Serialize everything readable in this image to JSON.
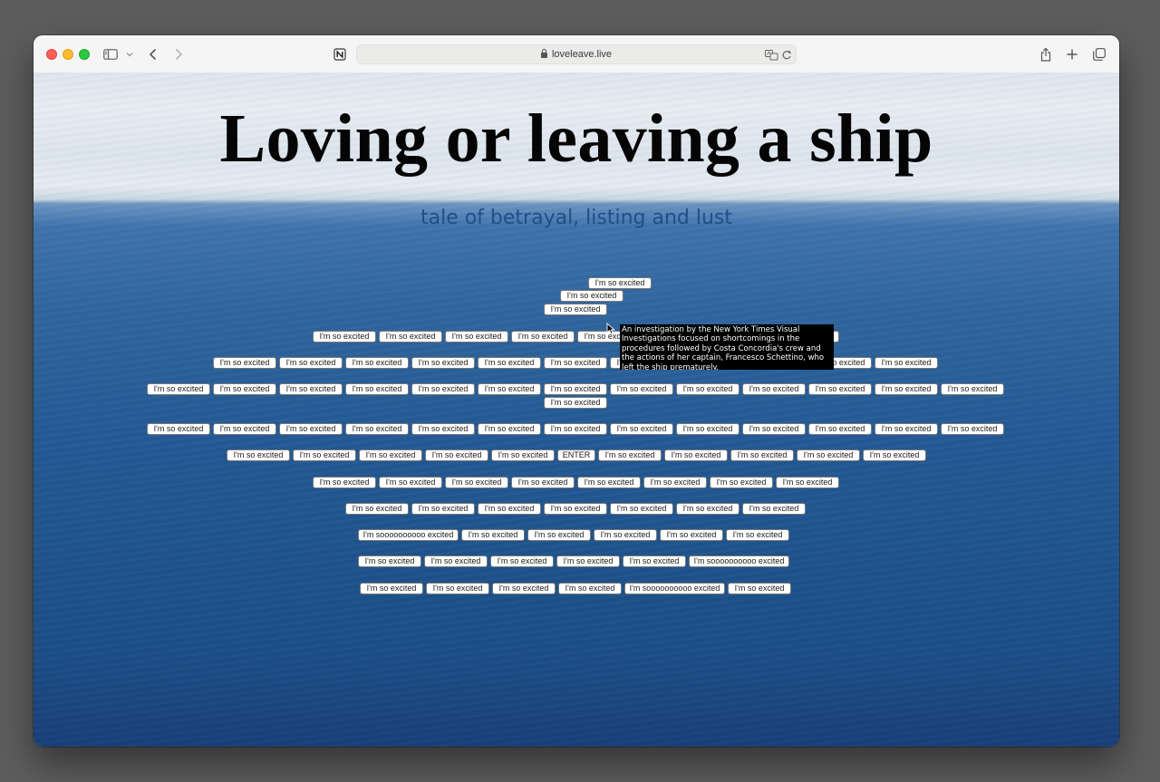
{
  "browser": {
    "url": "loveleave.live"
  },
  "page": {
    "title": "Loving or leaving a ship",
    "subtitle": "tale of betrayal, listing and lust",
    "tooltip": "An investigation by the New York Times Visual Investigations focused on shortcomings in the procedures followed by Costa Concordia's crew and the actions of her captain, Francesco Schettino, who left the ship prematurely.",
    "button_label": "I'm so excited",
    "long_label": "I'm soooooooooo excited",
    "enter_label": "ENTER"
  },
  "rows": [
    [
      {
        "t": "s"
      }
    ],
    [
      {
        "t": "s"
      }
    ],
    [
      {
        "t": "s"
      }
    ],
    [
      {
        "t": "s"
      },
      {
        "t": "s"
      },
      {
        "t": "s"
      },
      {
        "t": "s"
      },
      {
        "t": "s"
      },
      {
        "t": "s"
      },
      {
        "t": "s"
      },
      {
        "t": "s"
      }
    ],
    [
      {
        "t": "s"
      },
      {
        "t": "s"
      },
      {
        "t": "s"
      },
      {
        "t": "s"
      },
      {
        "t": "s"
      },
      {
        "t": "s"
      },
      {
        "t": "s"
      },
      {
        "t": "s"
      },
      {
        "t": "s"
      },
      {
        "t": "s"
      },
      {
        "t": "s"
      }
    ],
    [
      {
        "t": "s"
      },
      {
        "t": "s"
      },
      {
        "t": "s"
      },
      {
        "t": "s"
      },
      {
        "t": "s"
      },
      {
        "t": "s"
      },
      {
        "t": "s"
      },
      {
        "t": "s"
      },
      {
        "t": "s"
      },
      {
        "t": "s"
      },
      {
        "t": "s"
      },
      {
        "t": "s"
      },
      {
        "t": "s"
      }
    ],
    [
      {
        "t": "s"
      }
    ],
    [
      {
        "t": "s"
      },
      {
        "t": "s"
      },
      {
        "t": "s"
      },
      {
        "t": "s"
      },
      {
        "t": "s"
      },
      {
        "t": "s"
      },
      {
        "t": "s"
      },
      {
        "t": "s"
      },
      {
        "t": "s"
      },
      {
        "t": "s"
      },
      {
        "t": "s"
      },
      {
        "t": "s"
      },
      {
        "t": "s"
      }
    ],
    [
      {
        "t": "s"
      },
      {
        "t": "s"
      },
      {
        "t": "s"
      },
      {
        "t": "s"
      },
      {
        "t": "s"
      },
      {
        "t": "e"
      },
      {
        "t": "s"
      },
      {
        "t": "s"
      },
      {
        "t": "s"
      },
      {
        "t": "s"
      },
      {
        "t": "s"
      }
    ],
    [
      {
        "t": "s"
      },
      {
        "t": "s"
      },
      {
        "t": "s"
      },
      {
        "t": "s"
      },
      {
        "t": "s"
      },
      {
        "t": "s"
      },
      {
        "t": "s"
      },
      {
        "t": "s"
      }
    ],
    [
      {
        "t": "s"
      },
      {
        "t": "s"
      },
      {
        "t": "s"
      },
      {
        "t": "s"
      },
      {
        "t": "s"
      },
      {
        "t": "s"
      },
      {
        "t": "s"
      }
    ],
    [
      {
        "t": "l"
      },
      {
        "t": "s"
      },
      {
        "t": "s"
      },
      {
        "t": "s"
      },
      {
        "t": "s"
      },
      {
        "t": "s"
      }
    ],
    [
      {
        "t": "s"
      },
      {
        "t": "s"
      },
      {
        "t": "s"
      },
      {
        "t": "s"
      },
      {
        "t": "s"
      },
      {
        "t": "l"
      }
    ],
    [
      {
        "t": "s"
      },
      {
        "t": "s"
      },
      {
        "t": "s"
      },
      {
        "t": "s"
      },
      {
        "t": "l"
      },
      {
        "t": "s"
      }
    ]
  ]
}
